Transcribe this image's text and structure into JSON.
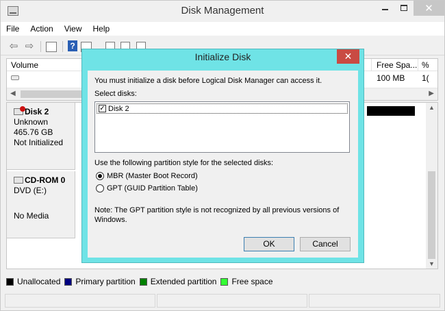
{
  "window": {
    "title": "Disk Management",
    "close_glyph": "✕"
  },
  "menu": [
    "File",
    "Action",
    "View",
    "Help"
  ],
  "toolbar": {
    "back_glyph": "⇦",
    "forward_glyph": "⇨",
    "help_glyph": "?"
  },
  "volume_list": {
    "columns": {
      "volume": "Volume",
      "free_space": "Free Spa...",
      "percent_free": "%"
    },
    "rows": [
      {
        "free_space": "100 MB",
        "percent_free": "1("
      }
    ]
  },
  "disks": [
    {
      "name": "Disk 2",
      "type": "Unknown",
      "size": "465.76 GB",
      "status": "Not Initialized"
    },
    {
      "name": "CD-ROM 0",
      "type": "DVD (E:)",
      "size": "",
      "status": "No Media"
    }
  ],
  "legend": [
    {
      "label": "Unallocated",
      "color": "#000000"
    },
    {
      "label": "Primary partition",
      "color": "#000080"
    },
    {
      "label": "Extended partition",
      "color": "#008000"
    },
    {
      "label": "Free space",
      "color": "#33ff33"
    }
  ],
  "dialog": {
    "title": "Initialize Disk",
    "close_glyph": "✕",
    "message": "You must initialize a disk before Logical Disk Manager can access it.",
    "select_label": "Select disks:",
    "disks": [
      {
        "label": "Disk 2",
        "checked": true
      }
    ],
    "partition_label": "Use the following partition style for the selected disks:",
    "options": {
      "mbr": "MBR (Master Boot Record)",
      "gpt": "GPT (GUID Partition Table)"
    },
    "selected_option": "mbr",
    "note": "Note: The GPT partition style is not recognized by all previous versions of Windows.",
    "ok_label": "OK",
    "cancel_label": "Cancel"
  }
}
